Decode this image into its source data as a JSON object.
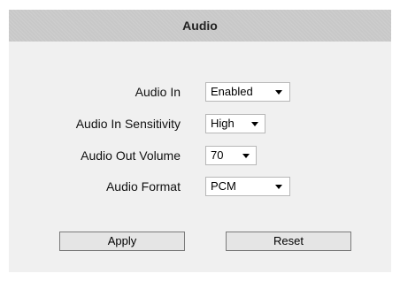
{
  "header": {
    "title": "Audio"
  },
  "fields": {
    "audio_in": {
      "label": "Audio In",
      "value": "Enabled"
    },
    "audio_in_sensitivity": {
      "label": "Audio In Sensitivity",
      "value": "High"
    },
    "audio_out_volume": {
      "label": "Audio Out Volume",
      "value": "70"
    },
    "audio_format": {
      "label": "Audio Format",
      "value": "PCM"
    }
  },
  "buttons": {
    "apply": "Apply",
    "reset": "Reset"
  },
  "icons": {
    "dropdown": "chevron-down-icon"
  },
  "colors": {
    "header_bg": "#c8c8c8",
    "panel_bg": "#f0f0f0"
  }
}
